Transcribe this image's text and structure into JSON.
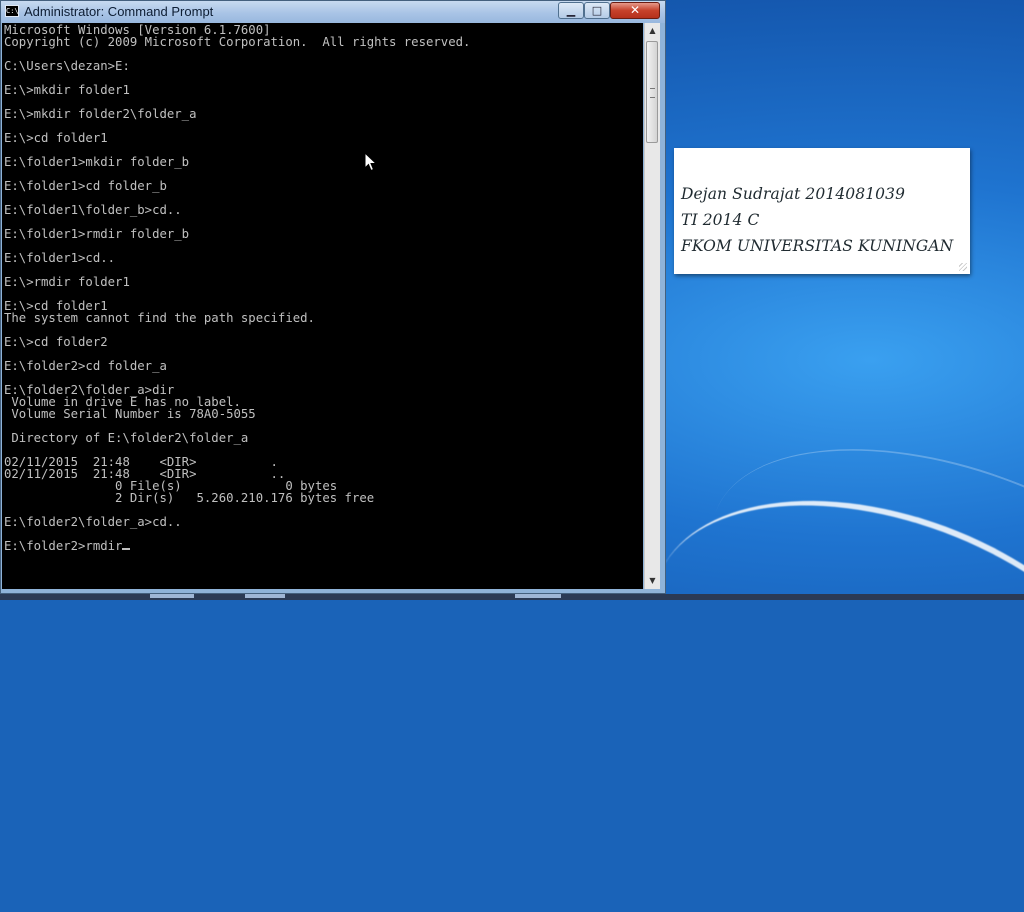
{
  "window": {
    "title": "Administrator: Command Prompt",
    "icon_label": "C:\\",
    "buttons": {
      "minimize": "▁",
      "maximize": "□",
      "close": "✕"
    }
  },
  "console": {
    "lines": [
      "Microsoft Windows [Version 6.1.7600]",
      "Copyright (c) 2009 Microsoft Corporation.  All rights reserved.",
      "",
      "C:\\Users\\dezan>E:",
      "",
      "E:\\>mkdir folder1",
      "",
      "E:\\>mkdir folder2\\folder_a",
      "",
      "E:\\>cd folder1",
      "",
      "E:\\folder1>mkdir folder_b",
      "",
      "E:\\folder1>cd folder_b",
      "",
      "E:\\folder1\\folder_b>cd..",
      "",
      "E:\\folder1>rmdir folder_b",
      "",
      "E:\\folder1>cd..",
      "",
      "E:\\>rmdir folder1",
      "",
      "E:\\>cd folder1",
      "The system cannot find the path specified.",
      "",
      "E:\\>cd folder2",
      "",
      "E:\\folder2>cd folder_a",
      "",
      "E:\\folder2\\folder_a>dir",
      " Volume in drive E has no label.",
      " Volume Serial Number is 78A0-5055",
      "",
      " Directory of E:\\folder2\\folder_a",
      "",
      "02/11/2015  21:48    <DIR>          .",
      "02/11/2015  21:48    <DIR>          ..",
      "               0 File(s)              0 bytes",
      "               2 Dir(s)   5.260.210.176 bytes free",
      "",
      "E:\\folder2\\folder_a>cd..",
      "",
      "E:\\folder2>rmdir"
    ]
  },
  "scrollbar": {
    "up_arrow": "▲",
    "down_arrow": "▼"
  },
  "sticky_note": {
    "line1": "Dejan Sudrajat 2014081039",
    "line2": "TI 2014 C",
    "line3": "FKOM UNIVERSITAS KUNINGAN"
  }
}
